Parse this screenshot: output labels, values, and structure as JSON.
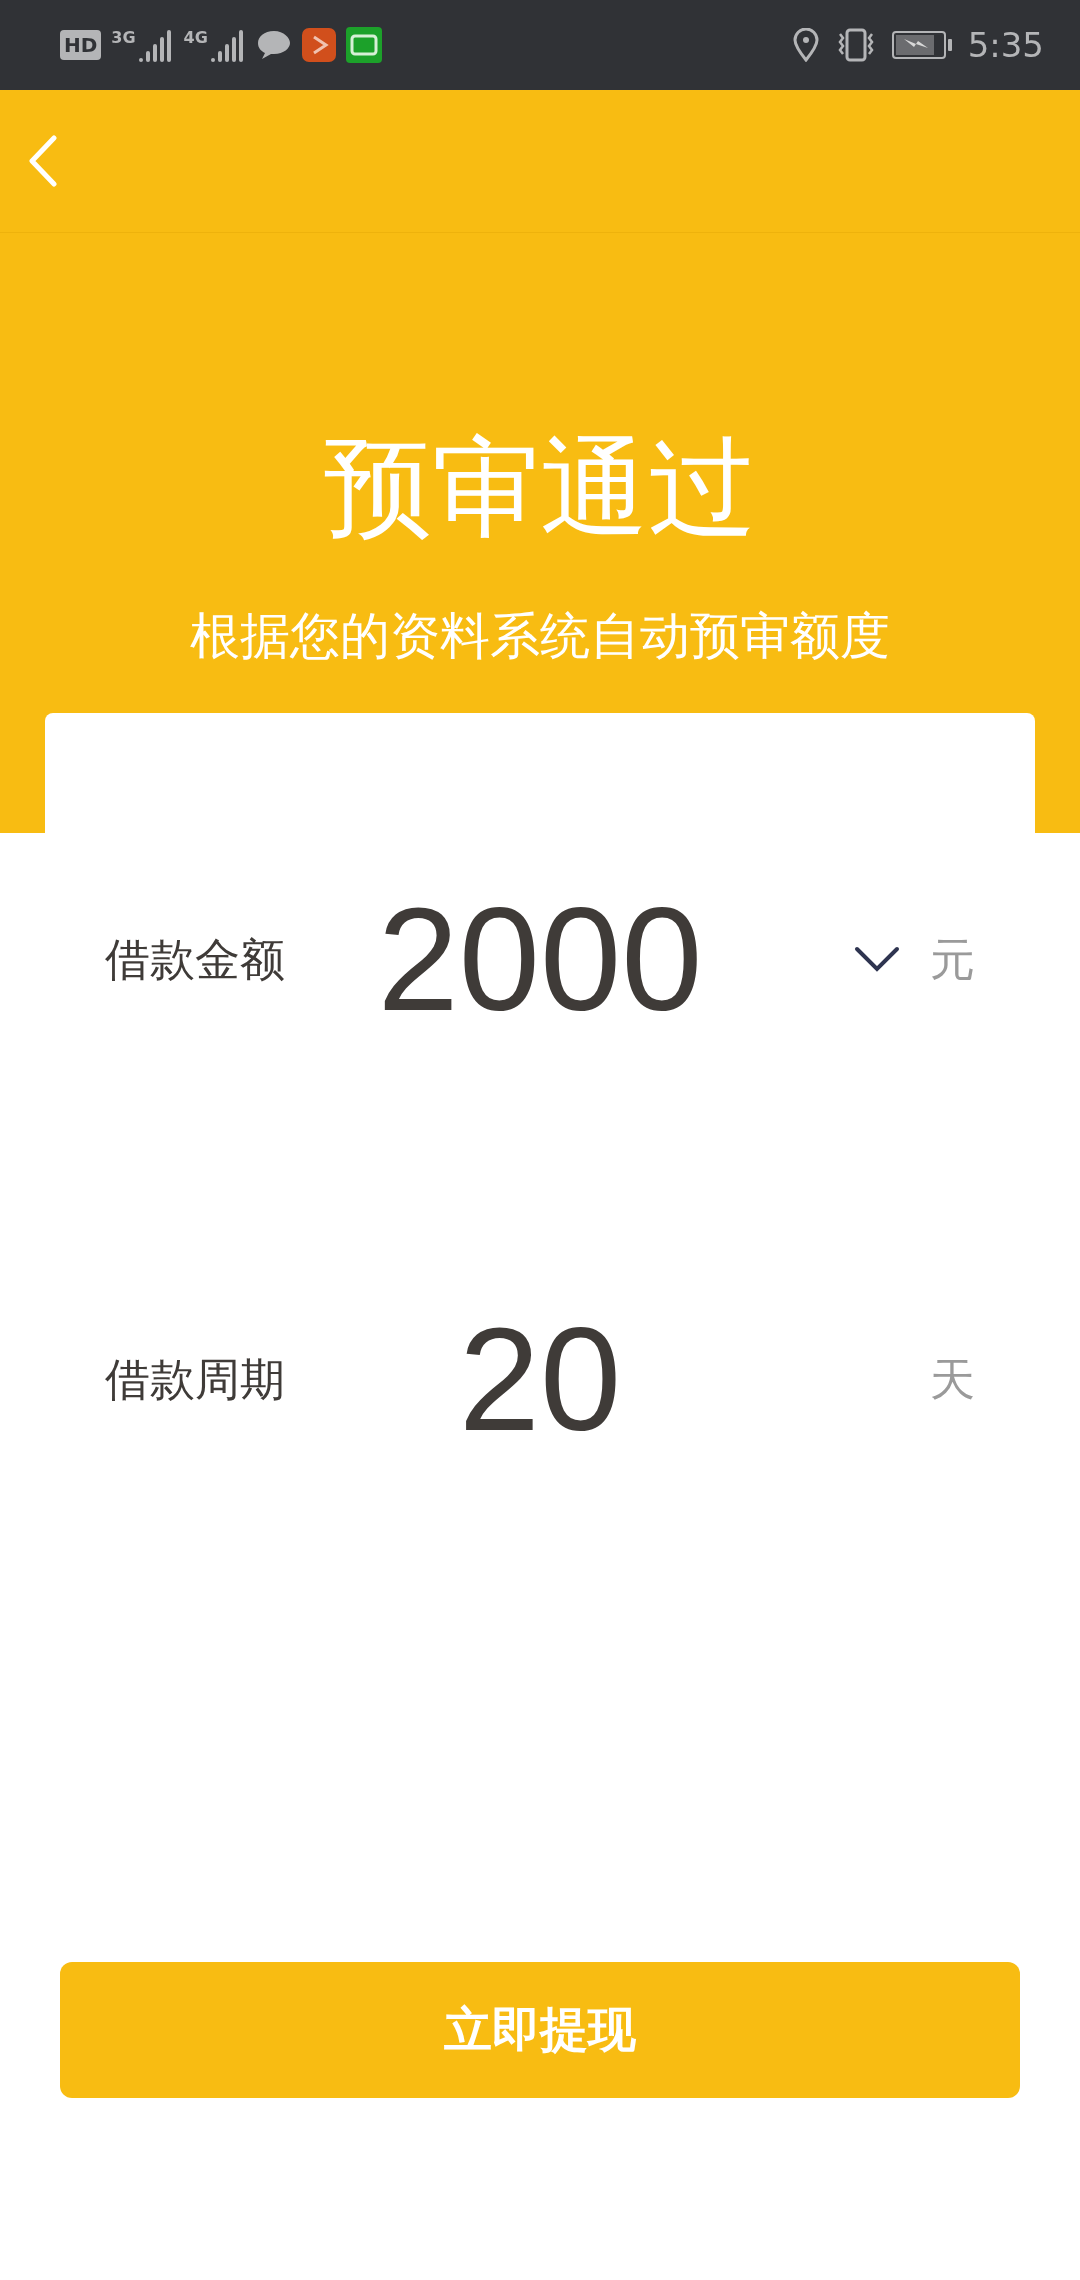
{
  "status_bar": {
    "hd_badge": "HD",
    "networks": [
      "3G",
      "4G"
    ],
    "time": "5:35"
  },
  "hero": {
    "title": "预审通过",
    "subtitle": "根据您的资料系统自动预审额度"
  },
  "fields": [
    {
      "label": "借款金额",
      "value": "2000",
      "unit": "元",
      "dropdown": true
    },
    {
      "label": "借款周期",
      "value": "20",
      "unit": "天",
      "dropdown": false
    }
  ],
  "button": "立即提现"
}
